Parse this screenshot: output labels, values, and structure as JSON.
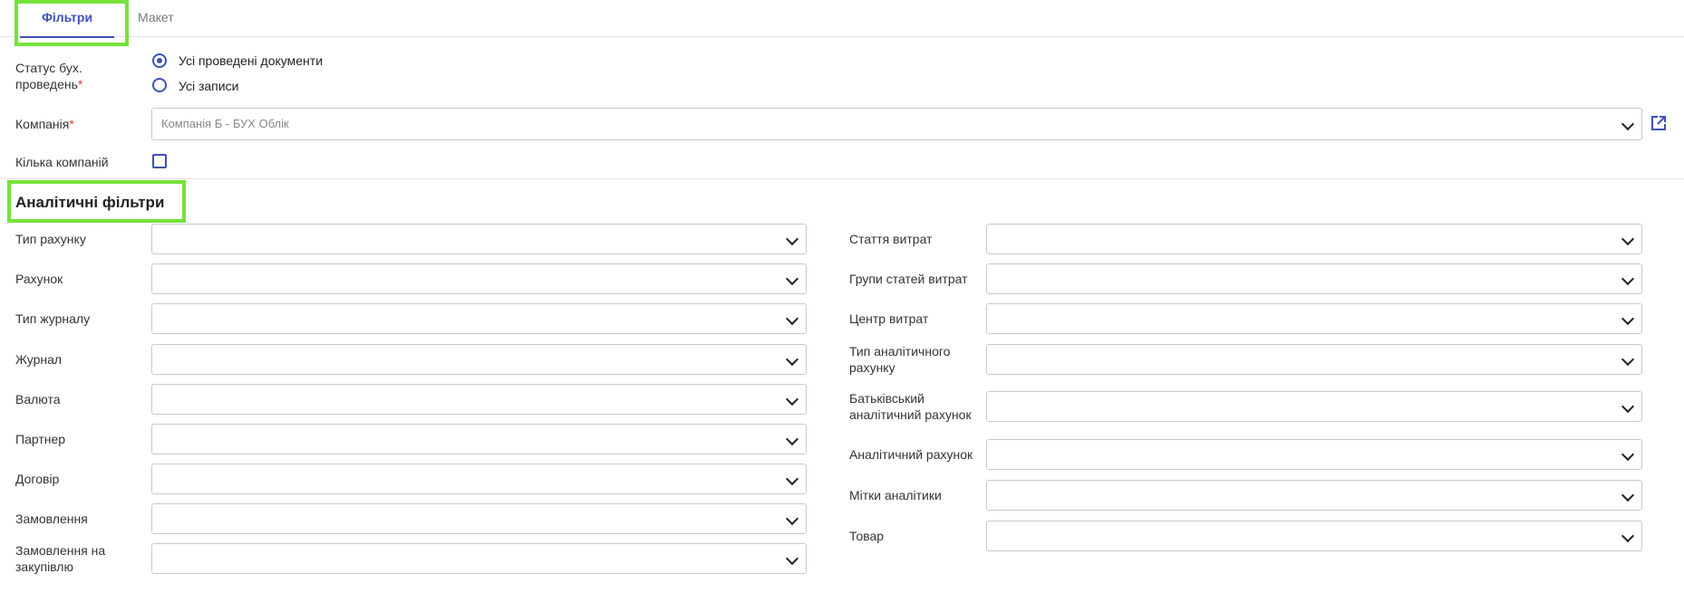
{
  "tabs": [
    {
      "label": "Фільтри",
      "active": true
    },
    {
      "label": "Макет",
      "active": false
    }
  ],
  "status": {
    "label": "Статус бух. проведень",
    "required": "*",
    "options": [
      {
        "label": "Усі проведені документи",
        "selected": true
      },
      {
        "label": "Усі записи",
        "selected": false
      }
    ]
  },
  "company": {
    "label": "Компанія",
    "required": "*",
    "value": "Компанія Б - БУХ Облік"
  },
  "multi_company": {
    "label": "Кілька компаній",
    "checked": false
  },
  "analytic": {
    "title": "Аналітичні фільтри",
    "left": [
      {
        "label": "Тип рахунку",
        "value": ""
      },
      {
        "label": "Рахунок",
        "value": ""
      },
      {
        "label": "Тип журналу",
        "value": ""
      },
      {
        "label": "Журнал",
        "value": ""
      },
      {
        "label": "Валюта",
        "value": ""
      },
      {
        "label": "Партнер",
        "value": ""
      },
      {
        "label": "Договір",
        "value": ""
      },
      {
        "label": "Замовлення",
        "value": ""
      },
      {
        "label": "Замовлення на закупівлю",
        "value": ""
      }
    ],
    "right": [
      {
        "label": "Стаття витрат",
        "value": ""
      },
      {
        "label": "Групи статей витрат",
        "value": ""
      },
      {
        "label": "Центр витрат",
        "value": ""
      },
      {
        "label": "Тип аналітичного рахунку",
        "value": ""
      },
      {
        "label": "Батьківський аналітичний рахунок",
        "value": ""
      },
      {
        "label": "Аналітичний рахунок",
        "value": ""
      },
      {
        "label": "Мітки аналітики",
        "value": ""
      },
      {
        "label": "Товар",
        "value": ""
      }
    ]
  },
  "colors": {
    "accent": "#3f51b5",
    "highlight": "#76e23a",
    "required": "#e53935"
  }
}
